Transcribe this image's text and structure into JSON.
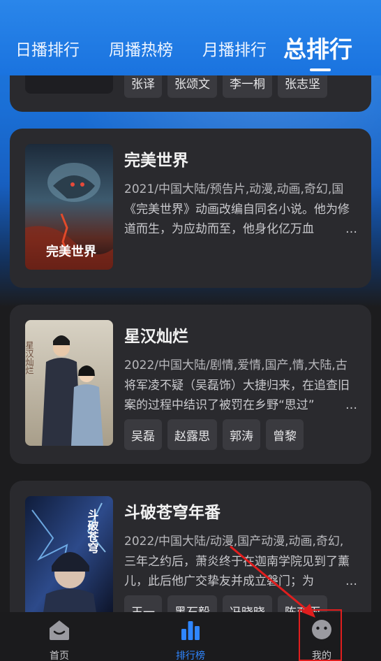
{
  "tabs": [
    {
      "label": "日播排行"
    },
    {
      "label": "周播热榜"
    },
    {
      "label": "月播排行"
    },
    {
      "label": "总排行"
    }
  ],
  "partial_card": {
    "actors": [
      "张译",
      "张颂文",
      "李一桐",
      "张志坚"
    ]
  },
  "cards": [
    {
      "title": "完美世界",
      "meta": "2021/中国大陆/预告片,动漫,动画,奇幻,国",
      "desc": "《完美世界》动画改编自同名小说。他为修道而生，为应劫而至，他身化亿万血",
      "poster_text": "完美世界"
    },
    {
      "title": "星汉灿烂",
      "meta": "2022/中国大陆/剧情,爱情,国产,情,大陆,古",
      "desc": "将军凌不疑（吴磊饰）大捷归来，在追查旧案的过程中结识了被罚在乡野“思过”",
      "actors": [
        "吴磊",
        "赵露思",
        "郭涛",
        "曾黎"
      ],
      "poster_text": "星汉灿烂"
    },
    {
      "title": "斗破苍穹年番",
      "meta": "2022/中国大陆/动漫,国产动漫,动画,奇幻,",
      "desc": "三年之约后，萧炎终于在迦南学院见到了薰儿，此后他广交挚友并成立磐门；为",
      "actors": [
        "王一",
        "黑石毅",
        "冯晓晓",
        "陈变雨"
      ],
      "poster_text": "斗破苍穹"
    }
  ],
  "bottom_nav": [
    {
      "label": "首页",
      "icon": "home-icon"
    },
    {
      "label": "排行榜",
      "icon": "bar-chart-icon"
    },
    {
      "label": "我的",
      "icon": "profile-face-icon"
    }
  ],
  "colors": {
    "accent": "#2f86ff",
    "header": "#1a73df",
    "card_bg": "#2a2a2e",
    "annotation": "#e01e1e"
  }
}
